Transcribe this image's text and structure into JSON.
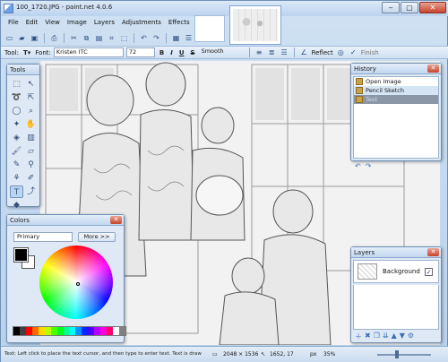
{
  "window": {
    "title": "100_1720.JPG - paint.net 4.0.6",
    "controls": {
      "minimize": "‒",
      "maximize": "▢",
      "close": "✕"
    }
  },
  "menu": [
    "File",
    "Edit",
    "View",
    "Image",
    "Layers",
    "Adjustments",
    "Effects"
  ],
  "toolbar2": {
    "tool_label": "Tool:",
    "font_label": "Font:",
    "font_value": "Kristen ITC",
    "size_value": "72",
    "bold": "B",
    "italic": "I",
    "underline": "U",
    "strike": "S",
    "smoothing": "Smooth",
    "reflect": "Reflect",
    "finish": "Finish"
  },
  "tools_panel": {
    "title": "Tools"
  },
  "history_panel": {
    "title": "History",
    "items": [
      {
        "label": "Open Image",
        "state": "normal"
      },
      {
        "label": "Pencil Sketch",
        "state": "selected"
      },
      {
        "label": "Text",
        "state": "dim"
      }
    ]
  },
  "layers_panel": {
    "title": "Layers",
    "layer_name": "Background",
    "visible_check": "✓"
  },
  "colors_panel": {
    "title": "Colors",
    "mode": "Primary",
    "more_button": "More >>",
    "primary_color": "#000000",
    "secondary_color": "#ffffff",
    "palette": [
      "#000000",
      "#404040",
      "#ff0000",
      "#ff6a00",
      "#ffd800",
      "#b6ff00",
      "#4cff00",
      "#00ff21",
      "#00ff90",
      "#00ffff",
      "#0094ff",
      "#0026ff",
      "#4800ff",
      "#b200ff",
      "#ff00dc",
      "#ff006e",
      "#ffffff",
      "#808080"
    ]
  },
  "status": {
    "hint": "Text: Left click to place the text cursor, and then type to enter text. Text is drawn with the primary color.",
    "image_size": "2048 × 1536",
    "cursor_pos": "1652, 17",
    "units": "px",
    "zoom": "35%"
  }
}
